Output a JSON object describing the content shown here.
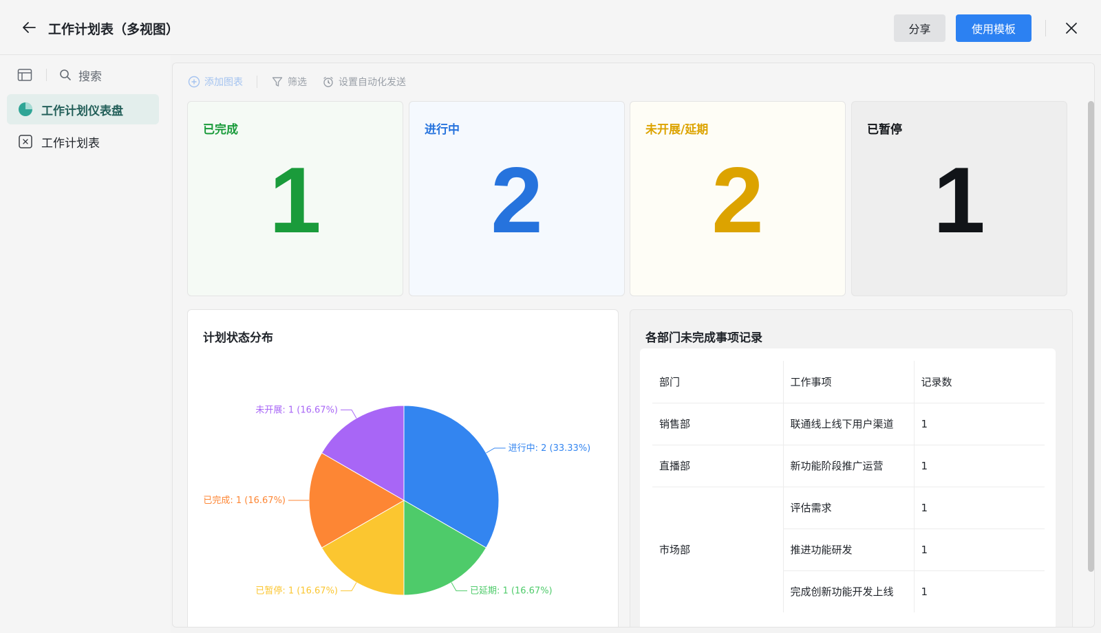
{
  "header": {
    "title": "工作计划表（多视图）",
    "share_label": "分享",
    "use_template_label": "使用模板"
  },
  "sidebar": {
    "search_label": "搜索",
    "items": [
      {
        "label": "工作计划仪表盘",
        "icon": "pie-chart-icon",
        "active": true
      },
      {
        "label": "工作计划表",
        "icon": "grid-table-icon",
        "active": false
      }
    ]
  },
  "toolbar": {
    "add_chart": "添加图表",
    "filter": "筛选",
    "auto_send": "设置自动化发送"
  },
  "stats": [
    {
      "title": "已完成",
      "value": "1",
      "color": "#1a9b3b",
      "bg": "#f5faf5"
    },
    {
      "title": "进行中",
      "value": "2",
      "color": "#2673dd",
      "bg": "#f5f9fe"
    },
    {
      "title": "未开展/延期",
      "value": "2",
      "color": "#dca300",
      "bg": "#fefdf6"
    },
    {
      "title": "已暂停",
      "value": "1",
      "color": "#111418",
      "bg": "#eeeeee"
    }
  ],
  "pie_panel": {
    "title": "计划状态分布"
  },
  "chart_data": {
    "type": "pie",
    "title": "计划状态分布",
    "slices": [
      {
        "name": "进行中",
        "value": 2,
        "label": "进行中: 2 (33.33%)",
        "color": "#3385f0"
      },
      {
        "name": "已延期",
        "value": 1,
        "label": "已延期: 1 (16.67%)",
        "color": "#4ecb6a"
      },
      {
        "name": "已暂停",
        "value": 1,
        "label": "已暂停: 1 (16.67%)",
        "color": "#fbc630"
      },
      {
        "name": "已完成",
        "value": 1,
        "label": "已完成: 1 (16.67%)",
        "color": "#fd8634"
      },
      {
        "name": "未开展",
        "value": 1,
        "label": "未开展: 1 (16.67%)",
        "color": "#a866f6"
      }
    ]
  },
  "table_panel": {
    "title": "各部门未完成事项记录",
    "columns": [
      "部门",
      "工作事项",
      "记录数"
    ],
    "rows": [
      {
        "dept": "销售部",
        "task": "联通线上线下用户渠道",
        "count": "1"
      },
      {
        "dept": "直播部",
        "task": "新功能阶段推广运营",
        "count": "1"
      },
      {
        "dept": "市场部",
        "task": "评估需求",
        "count": "1"
      },
      {
        "dept": "",
        "task": "推进功能研发",
        "count": "1"
      },
      {
        "dept": "",
        "task": "完成创新功能开发上线",
        "count": "1"
      }
    ]
  }
}
